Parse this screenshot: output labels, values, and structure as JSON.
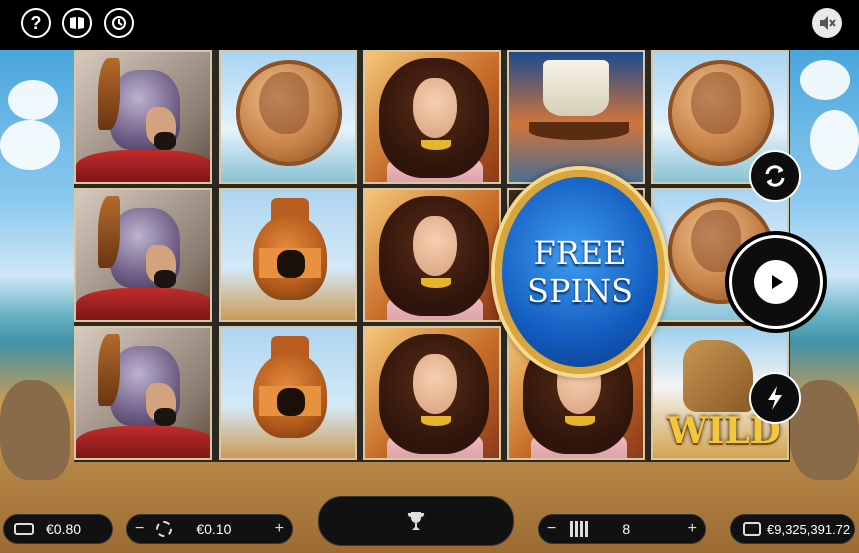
{
  "topbar": {
    "help_icon": "question-mark",
    "paytable_icon": "book",
    "history_icon": "clock-history",
    "sound_icon": "speaker-muted"
  },
  "reels": [
    [
      "warrior",
      "warrior",
      "warrior"
    ],
    [
      "coin",
      "vase",
      "vase"
    ],
    [
      "lady",
      "lady",
      "lady"
    ],
    [
      "ship",
      "free_spins",
      "lady"
    ],
    [
      "coin",
      "coin",
      "wild"
    ]
  ],
  "overlay": {
    "free_spins_line1": "FREE",
    "free_spins_line2": "SPINS",
    "wild_label": "WILD"
  },
  "side_buttons": {
    "autoplay_icon": "refresh-arrows",
    "spin_icon": "play",
    "turbo_icon": "lightning"
  },
  "bottombar": {
    "win_amount": "€0.80",
    "bet_minus": "−",
    "bet_value": "€0.10",
    "bet_plus": "+",
    "trophy_icon": "trophy",
    "lines_minus": "−",
    "lines_value": "8",
    "lines_plus": "+",
    "balance": "€9,325,391.72"
  },
  "colors": {
    "accent_gold": "#d8a63c",
    "free_spins_blue": "#135cbf",
    "wild_gold": "#f3c63c"
  }
}
